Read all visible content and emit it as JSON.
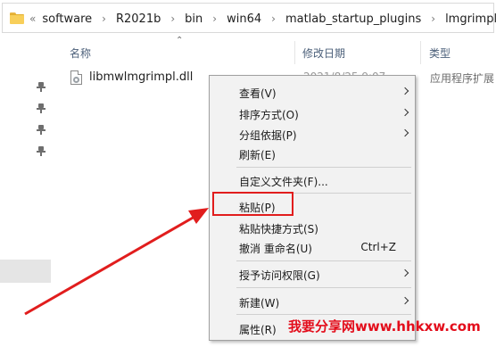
{
  "address_bar": {
    "lead": "«",
    "crumbs": [
      "software",
      "R2021b",
      "bin",
      "win64",
      "matlab_startup_plugins",
      "lmgrimpl"
    ],
    "separator": "›"
  },
  "columns": {
    "name": "名称",
    "date": "修改日期",
    "type": "类型"
  },
  "file": {
    "name": "libmwlmgrimpl.dll",
    "date": "2021/8/25 9:07",
    "type": "应用程序扩展"
  },
  "context_menu": {
    "items": [
      {
        "label": "查看(V)",
        "submenu": true
      },
      {
        "label": "排序方式(O)",
        "submenu": true
      },
      {
        "label": "分组依据(P)",
        "submenu": true
      },
      {
        "label": "刷新(E)",
        "submenu": false
      },
      {
        "label": "自定义文件夹(F)...",
        "submenu": false
      },
      {
        "label": "粘贴(P)",
        "submenu": false
      },
      {
        "label": "粘贴快捷方式(S)",
        "submenu": false
      },
      {
        "label": "撤消 重命名(U)",
        "shortcut": "Ctrl+Z",
        "submenu": false
      },
      {
        "label": "授予访问权限(G)",
        "submenu": true
      },
      {
        "label": "新建(W)",
        "submenu": true
      },
      {
        "label": "属性(R)",
        "submenu": false
      }
    ]
  },
  "watermark": "我要分享网www.hhkxw.com",
  "colors": {
    "highlight": "#e11d1d",
    "menu_bg": "#f2f2f2",
    "header_text": "#4c607a"
  }
}
